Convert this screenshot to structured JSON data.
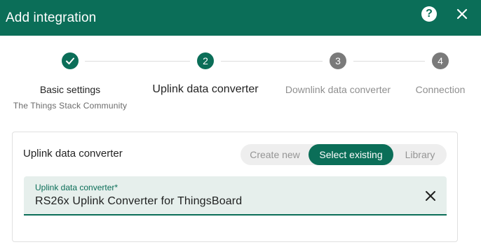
{
  "dialog": {
    "title": "Add integration",
    "help_icon": "help-circle-icon",
    "help_glyph": "?",
    "close_icon": "close-icon"
  },
  "stepper": {
    "steps": [
      {
        "number": "1",
        "label": "Basic settings",
        "sublabel": "The Things Stack Community",
        "state": "completed",
        "icon": "check-icon"
      },
      {
        "number": "2",
        "label": "Uplink data converter",
        "state": "current"
      },
      {
        "number": "3",
        "label": "Downlink data converter",
        "state": "pending"
      },
      {
        "number": "4",
        "label": "Connection",
        "state": "pending"
      }
    ]
  },
  "card": {
    "title": "Uplink data converter",
    "toggle": {
      "options": [
        "Create new",
        "Select existing",
        "Library"
      ],
      "selected": "Select existing"
    },
    "field": {
      "label": "Uplink data converter*",
      "value": "RS26x Uplink Converter for ThingsBoard",
      "clear_icon": "close-icon"
    }
  },
  "colors": {
    "primary": "#0b6e58",
    "inactive_step": "#7a7a7a",
    "field_background": "#e6efec",
    "toggle_background": "#eeeeee"
  }
}
